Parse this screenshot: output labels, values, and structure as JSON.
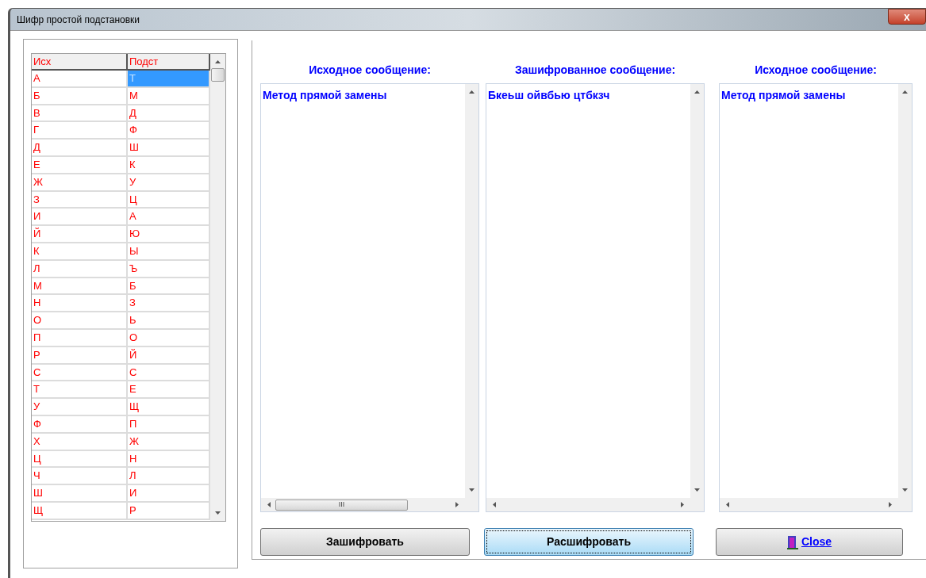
{
  "window": {
    "title": "Шифр простой подстановки",
    "close_label": "x"
  },
  "table": {
    "columns": [
      "Исх",
      "Подст"
    ],
    "rows": [
      {
        "source": "А",
        "substitute": "Т",
        "selected": true
      },
      {
        "source": "Б",
        "substitute": "М",
        "selected": false
      },
      {
        "source": "В",
        "substitute": "Д",
        "selected": false
      },
      {
        "source": "Г",
        "substitute": "Ф",
        "selected": false
      },
      {
        "source": "Д",
        "substitute": "Ш",
        "selected": false
      },
      {
        "source": "Е",
        "substitute": "К",
        "selected": false
      },
      {
        "source": "Ж",
        "substitute": "У",
        "selected": false
      },
      {
        "source": "З",
        "substitute": "Ц",
        "selected": false
      },
      {
        "source": "И",
        "substitute": "А",
        "selected": false
      },
      {
        "source": "Й",
        "substitute": "Ю",
        "selected": false
      },
      {
        "source": "К",
        "substitute": "Ы",
        "selected": false
      },
      {
        "source": "Л",
        "substitute": "Ъ",
        "selected": false
      },
      {
        "source": "М",
        "substitute": "Б",
        "selected": false
      },
      {
        "source": "Н",
        "substitute": "З",
        "selected": false
      },
      {
        "source": "О",
        "substitute": "Ь",
        "selected": false
      },
      {
        "source": "П",
        "substitute": "О",
        "selected": false
      },
      {
        "source": "Р",
        "substitute": "Й",
        "selected": false
      },
      {
        "source": "С",
        "substitute": "С",
        "selected": false
      },
      {
        "source": "Т",
        "substitute": "Е",
        "selected": false
      },
      {
        "source": "У",
        "substitute": "Щ",
        "selected": false
      },
      {
        "source": "Ф",
        "substitute": "П",
        "selected": false
      },
      {
        "source": "Х",
        "substitute": "Ж",
        "selected": false
      },
      {
        "source": "Ц",
        "substitute": "Н",
        "selected": false
      },
      {
        "source": "Ч",
        "substitute": "Л",
        "selected": false
      },
      {
        "source": "Ш",
        "substitute": "И",
        "selected": false
      },
      {
        "source": "Щ",
        "substitute": "Р",
        "selected": false
      }
    ]
  },
  "memos": [
    {
      "label": "Исходное сообщение:",
      "text": "Метод прямой замены",
      "hscroll_thumb": true,
      "hscroll_grip": "III"
    },
    {
      "label": "Зашифрованное сообщение:",
      "text": "Бкеьш ойвбью цтбкзч",
      "hscroll_thumb": false
    },
    {
      "label": "Исходное сообщение:",
      "text": "Метод прямой замены",
      "hscroll_thumb": false
    }
  ],
  "buttons": [
    {
      "label": "Зашифровать",
      "kind": "plain",
      "focused": false
    },
    {
      "label": "Расшифровать",
      "kind": "plain",
      "focused": true
    },
    {
      "label": "Close",
      "kind": "close",
      "focused": false
    }
  ]
}
